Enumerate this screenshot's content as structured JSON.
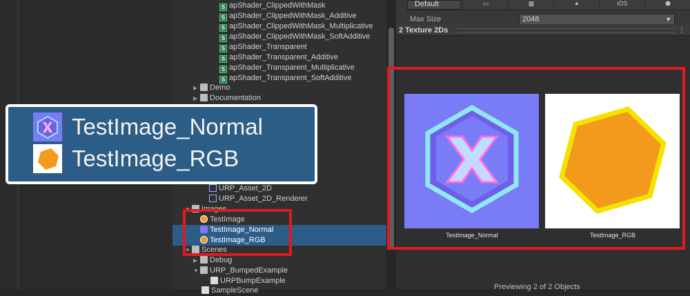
{
  "tree": {
    "items": [
      {
        "label": "apShader_ClippedWithMask",
        "kind": "shader"
      },
      {
        "label": "apShader_ClippedWithMask_Additive",
        "kind": "shader"
      },
      {
        "label": "apShader_ClippedWithMask_Multiplicative",
        "kind": "shader"
      },
      {
        "label": "apShader_ClippedWithMask_SoftAdditive",
        "kind": "shader"
      },
      {
        "label": "apShader_Transparent",
        "kind": "shader"
      },
      {
        "label": "apShader_Transparent_Additive",
        "kind": "shader"
      },
      {
        "label": "apShader_Transparent_Multiplicative",
        "kind": "shader"
      },
      {
        "label": "apShader_Transparent_SoftAdditive",
        "kind": "shader"
      },
      {
        "label": "Demo",
        "kind": "folder"
      },
      {
        "label": "Documentation",
        "kind": "folder"
      },
      {
        "label": "URP_Asset_2D",
        "kind": "asset"
      },
      {
        "label": "URP_Asset_2D_Renderer",
        "kind": "asset"
      },
      {
        "label": "Images",
        "kind": "folder-open"
      },
      {
        "label": "TestImage",
        "kind": "image-rgb"
      },
      {
        "label": "TestImage_Normal",
        "kind": "image-normal"
      },
      {
        "label": "TestImage_RGB",
        "kind": "image-rgb"
      },
      {
        "label": "Scenes",
        "kind": "folder-open"
      },
      {
        "label": "Debug",
        "kind": "folder"
      },
      {
        "label": "URP_BumpedExample",
        "kind": "folder-open"
      },
      {
        "label": "URPBumpExample",
        "kind": "scene"
      },
      {
        "label": "SampleScene",
        "kind": "scene"
      }
    ]
  },
  "zoom": {
    "item1": "TestImage_Normal",
    "item2": "TestImage_RGB"
  },
  "inspector": {
    "default_tab": "Default",
    "platform_tabs": [
      "",
      "",
      "",
      "iOS",
      ""
    ],
    "max_size_label": "Max Size",
    "max_size_value": "2048",
    "preview_title": "2 Texture 2Ds",
    "thumb1_label": "TestImage_Normal",
    "thumb2_label": "TestImage_RGB",
    "status": "Previewing 2 of 2 Objects"
  },
  "colors": {
    "highlight": "#e11a22",
    "selection": "#2c5d87",
    "normal_bg": "#7a7cf7",
    "rgb_fill": "#f39a1c",
    "rgb_border": "#f4e300"
  }
}
